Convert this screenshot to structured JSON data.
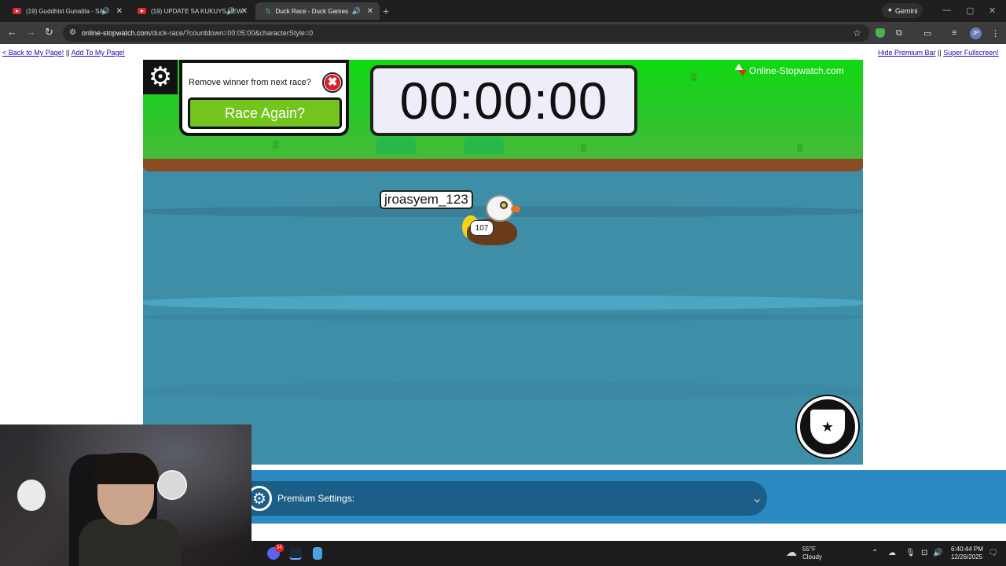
{
  "browser": {
    "tabs": [
      {
        "title": "(19) Guddhist Gunatita - SA",
        "active": false
      },
      {
        "title": "(19) UPDATE SA KUKUYS NEW",
        "active": false
      },
      {
        "title": "Duck Race - Duck Games",
        "active": true
      }
    ],
    "gemini_label": "Gemini",
    "url_host": "online-stopwatch.com",
    "url_path": "/duck-race/?countdown=00:05:00&characterStyle=0",
    "profile_initials": "JP"
  },
  "page": {
    "back_link": "< Back to My Page!",
    "separator": "||",
    "add_link": "Add To My Page!",
    "hide_premium": "Hide Premium Bar",
    "super_fullscreen": "Super Fullscreen!"
  },
  "game": {
    "remove_winner_question": "Remove winner from next race?",
    "race_again": "Race Again?",
    "timer": "00:00:00",
    "brand": "Online-Stopwatch.com",
    "racer_name": "jroasyem_123",
    "racer_number": "107"
  },
  "premium": {
    "label": "Premium Settings:"
  },
  "taskbar": {
    "temperature": "55°F",
    "weather": "Cloudy",
    "time": "6:40:44 PM",
    "date": "12/26/2025",
    "discord_badge": "34"
  },
  "colors": {
    "grass": "#0fd90f",
    "water": "#3f8ea8",
    "race_button": "#73c41d",
    "premium_strip": "#2b8ac4",
    "close_button": "#d91f2a"
  }
}
